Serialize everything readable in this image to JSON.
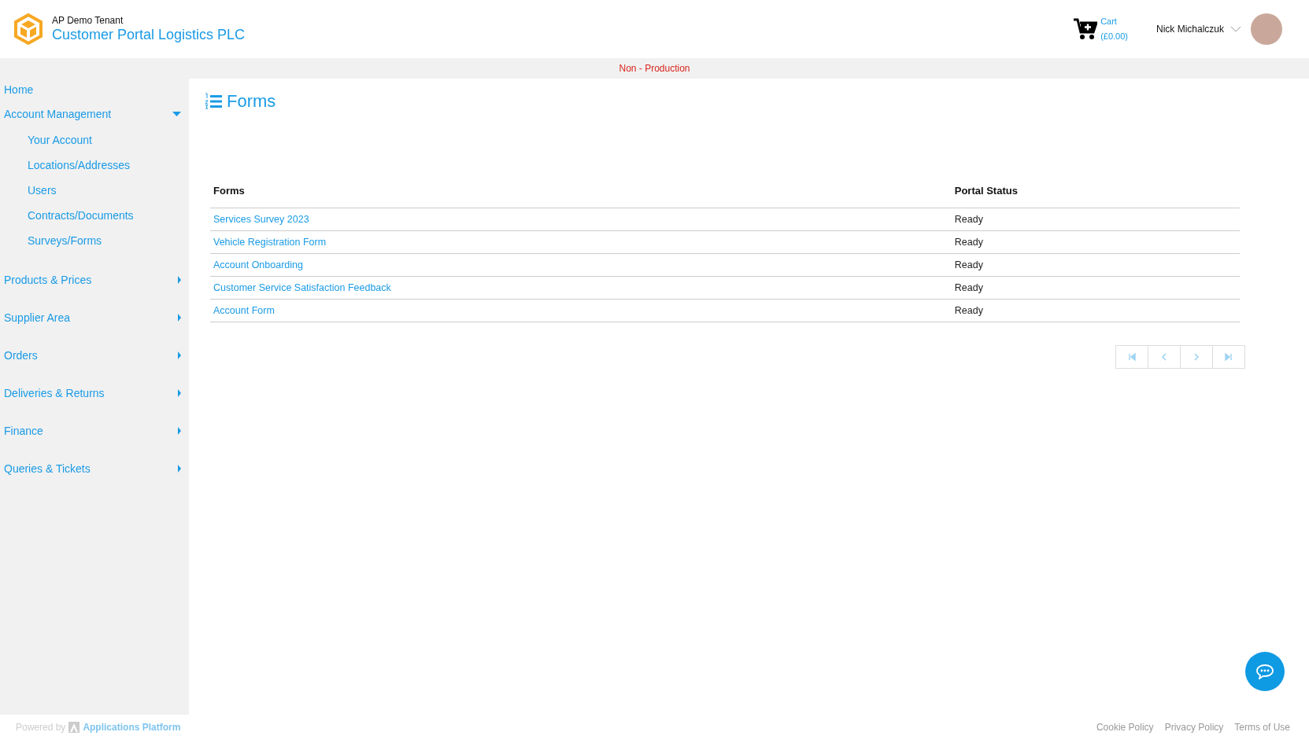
{
  "header": {
    "tenant": "AP Demo Tenant",
    "title": "Customer Portal Logistics PLC",
    "cart_label": "Cart",
    "cart_total": "(£0.00)",
    "user_name": "Nick Michalczuk"
  },
  "environment_banner": "Non - Production",
  "sidebar": {
    "items": [
      {
        "label": "Home",
        "kind": "link"
      },
      {
        "label": "Account Management",
        "kind": "group",
        "expanded": true,
        "children": [
          {
            "label": "Your Account"
          },
          {
            "label": "Locations/Addresses"
          },
          {
            "label": "Users"
          },
          {
            "label": "Contracts/Documents"
          },
          {
            "label": "Surveys/Forms"
          }
        ]
      },
      {
        "label": "Products & Prices",
        "kind": "group",
        "expanded": false
      },
      {
        "label": "Supplier Area",
        "kind": "group",
        "expanded": false
      },
      {
        "label": "Orders",
        "kind": "group",
        "expanded": false
      },
      {
        "label": "Deliveries & Returns",
        "kind": "group",
        "expanded": false
      },
      {
        "label": "Finance",
        "kind": "group",
        "expanded": false
      },
      {
        "label": "Queries & Tickets",
        "kind": "group",
        "expanded": false
      }
    ]
  },
  "page_title": "Forms",
  "table": {
    "columns": [
      "Forms",
      "Portal Status"
    ],
    "rows": [
      [
        "Services Survey 2023",
        "Ready"
      ],
      [
        "Vehicle Registration Form",
        "Ready"
      ],
      [
        "Account Onboarding",
        "Ready"
      ],
      [
        "Customer Service Satisfaction Feedback",
        "Ready"
      ],
      [
        "Account Form",
        "Ready"
      ]
    ]
  },
  "pager": [
    {
      "kind": "first",
      "disabled": true
    },
    {
      "kind": "previous",
      "disabled": true
    },
    {
      "kind": "next",
      "disabled": true
    },
    {
      "kind": "last",
      "disabled": true
    }
  ],
  "footer": {
    "powered_by": "Powered by",
    "platform": "Applications Platform",
    "links": [
      "Cookie Policy",
      "Privacy Policy",
      "Terms of Use"
    ]
  }
}
